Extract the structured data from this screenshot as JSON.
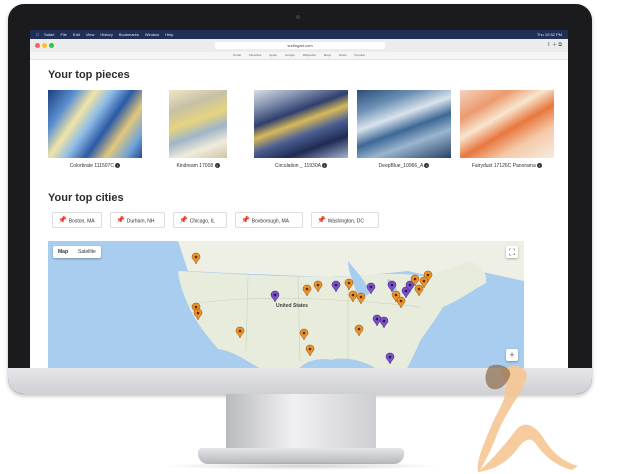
{
  "menubar": {
    "apple": "",
    "items": [
      "Safari",
      "File",
      "Edit",
      "View",
      "History",
      "Bookmarks",
      "Window",
      "Help"
    ],
    "status": "Thu 10:52 PM"
  },
  "browser": {
    "url": "surfingart.com",
    "bookmarks": [
      "Portal",
      "Favorites",
      "Apple",
      "Google",
      "Wikipedia",
      "Maps",
      "News",
      "Popular"
    ]
  },
  "sections": {
    "pieces_title": "Your top pieces",
    "cities_title": "Your top cities"
  },
  "pieces": [
    {
      "caption": "Colorbrate 111507C"
    },
    {
      "caption": "Kindream 17008"
    },
    {
      "caption": "Circulation _ 11930A"
    },
    {
      "caption": "DeepBlue_10966_A"
    },
    {
      "caption": "Fairydust 17126C Panorama"
    }
  ],
  "cities": [
    "Boston, MA",
    "Durham, NH",
    "Chicago, IL",
    "Boxborough, MA",
    "Washington, DC"
  ],
  "map": {
    "toggle": [
      "Map",
      "Satellite"
    ],
    "country_label": "United States",
    "fullscreen_icon": "fullscreen-icon",
    "zoom_in": "+",
    "colors": {
      "water": "#a9cdee",
      "land": "#e7ecdc",
      "canada": "#eef0e6",
      "pin_orange": "#e8922c",
      "pin_purple": "#7b4fc7"
    }
  },
  "icons": {
    "city_pin": "pushpin-icon",
    "info": "info-icon"
  }
}
